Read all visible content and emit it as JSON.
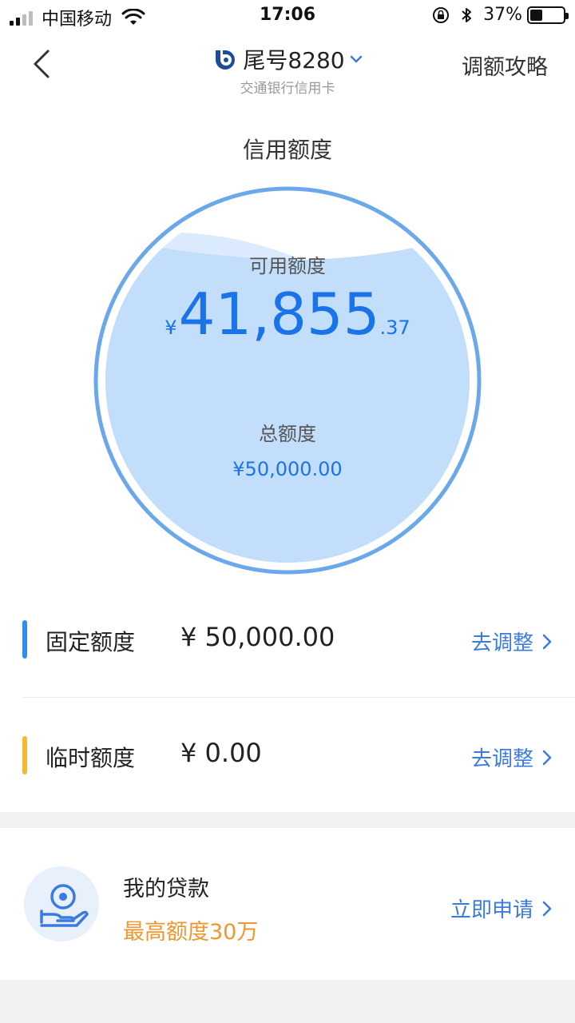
{
  "status_bar": {
    "carrier": "中国移动",
    "time": "17:06",
    "battery": "37%",
    "battery_level": 0.37
  },
  "nav": {
    "title": "尾号8280",
    "subtitle": "交通银行信用卡",
    "right_label": "调额攻略"
  },
  "section_title": "信用额度",
  "circle": {
    "available_label": "可用额度",
    "currency": "¥",
    "available_int": "41,855",
    "available_dec": ".37",
    "total_label": "总额度",
    "total_amount": "¥50,000.00"
  },
  "rows": [
    {
      "label": "固定额度",
      "value": "¥ 50,000.00",
      "action": "去调整",
      "bar_color": "#2f8ef0"
    },
    {
      "label": "临时额度",
      "value": "¥ 0.00",
      "action": "去调整",
      "bar_color": "#f5b82e"
    }
  ],
  "loan": {
    "title": "我的贷款",
    "subtitle": "最高额度30万",
    "action": "立即申请"
  },
  "colors": {
    "accent": "#3b7be0",
    "amount_blue": "#1a73e8",
    "orange": "#f0962e",
    "circle_fill": "#c2defa",
    "circle_ring": "#6aa8eb"
  }
}
